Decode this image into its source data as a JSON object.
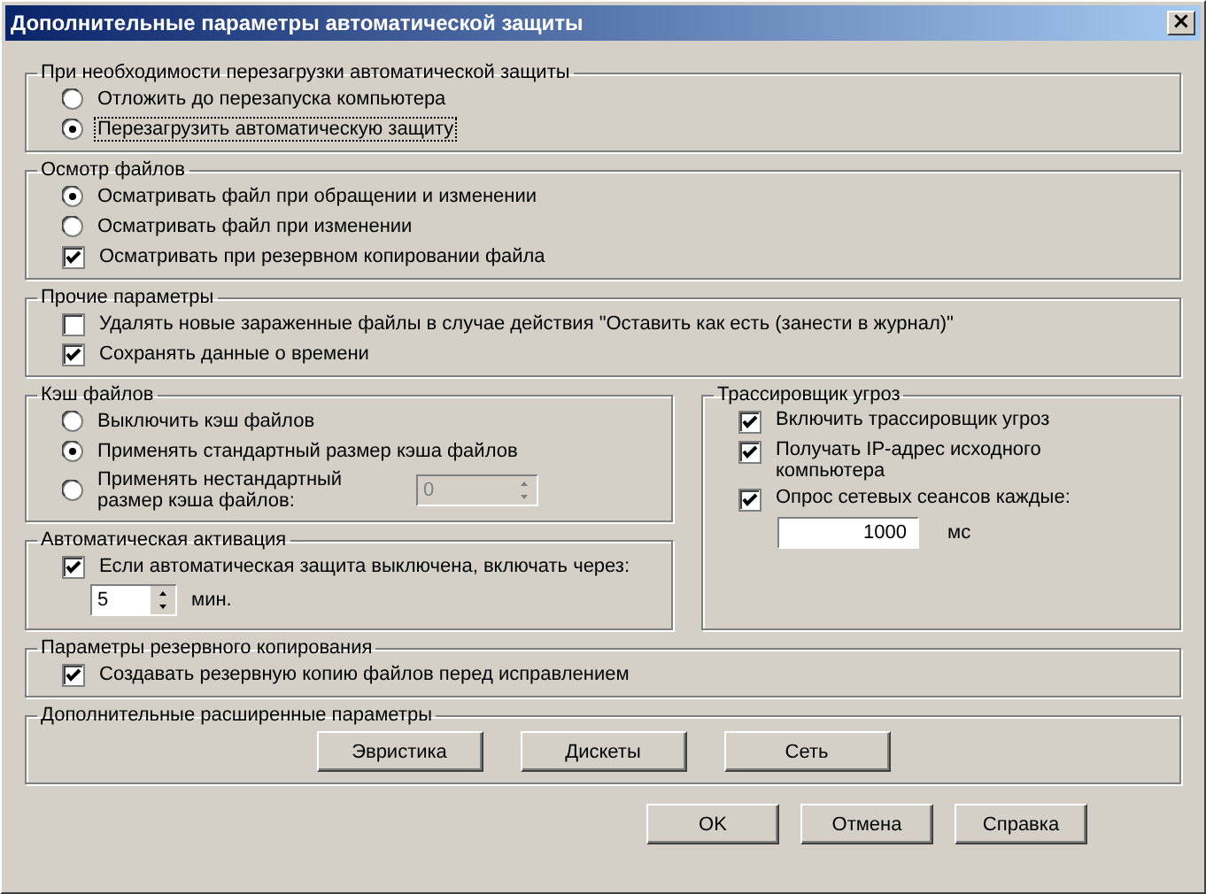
{
  "window": {
    "title": "Дополнительные параметры автоматической защиты",
    "close": "×"
  },
  "top_groups": [
    {
      "title": "При необходимости перезагрузки автоматической защиты",
      "items": [
        {
          "kind": "radio",
          "label": "Отложить до перезапуска компьютера",
          "selected": false
        },
        {
          "kind": "radio",
          "label": "Перезагрузить автоматическую защиту",
          "selected": true,
          "focused": true
        }
      ]
    },
    {
      "title": "Осмотр файлов",
      "items": [
        {
          "kind": "radio",
          "label": "Осматривать файл при обращении и изменении",
          "selected": true
        },
        {
          "kind": "radio",
          "label": "Осматривать файл при изменении",
          "selected": false
        },
        {
          "kind": "checkbox",
          "label": "Осматривать при резервном копировании файла",
          "checked": true
        }
      ]
    },
    {
      "title": "Прочие параметры",
      "items": [
        {
          "kind": "checkbox",
          "label": "Удалять новые зараженные файлы в случае действия \"Оставить как есть (занести в журнал)\"",
          "checked": false
        },
        {
          "kind": "checkbox",
          "label": "Сохранять данные о времени",
          "checked": true
        }
      ]
    }
  ],
  "left_groups": [
    {
      "title": "Кэш файлов",
      "items": [
        {
          "kind": "radio",
          "label": "Выключить кэш файлов",
          "selected": false
        },
        {
          "kind": "radio",
          "label": "Применять стандартный размер кэша файлов",
          "selected": true
        },
        {
          "kind": "radio",
          "label": "Применять нестандартный размер кэша файлов:",
          "selected": false,
          "spin": {
            "value": "0",
            "disabled": true
          }
        }
      ]
    },
    {
      "title": "Автоматическая активация",
      "items": [
        {
          "kind": "checkbox",
          "label": "Если автоматическая защита выключена, включать через:",
          "checked": true
        },
        {
          "kind": "spin",
          "value": "5",
          "unit": "мин.",
          "disabled": false
        }
      ]
    }
  ],
  "right_group": {
    "title": "Трассировщик угроз",
    "items": [
      {
        "kind": "checkbox",
        "label": "Включить трассировщик угроз",
        "checked": true
      },
      {
        "kind": "checkbox",
        "label": "Получать IP-адрес исходного компьютера",
        "checked": true
      },
      {
        "kind": "checkbox",
        "label": "Опрос сетевых сеансов каждые:",
        "checked": true
      },
      {
        "kind": "field",
        "value": "1000",
        "unit": "мс"
      }
    ]
  },
  "bottom_groups": [
    {
      "title": "Параметры резервного копирования",
      "items": [
        {
          "kind": "checkbox",
          "label": "Создавать резервную копию файлов перед исправлением",
          "checked": true
        }
      ]
    },
    {
      "title": "Дополнительные расширенные параметры",
      "items": [
        {
          "kind": "buttons",
          "labels": [
            "Эвристика",
            "Дискеты",
            "Сеть"
          ]
        }
      ]
    }
  ],
  "buttons": [
    "OK",
    "Отмена",
    "Справка"
  ]
}
